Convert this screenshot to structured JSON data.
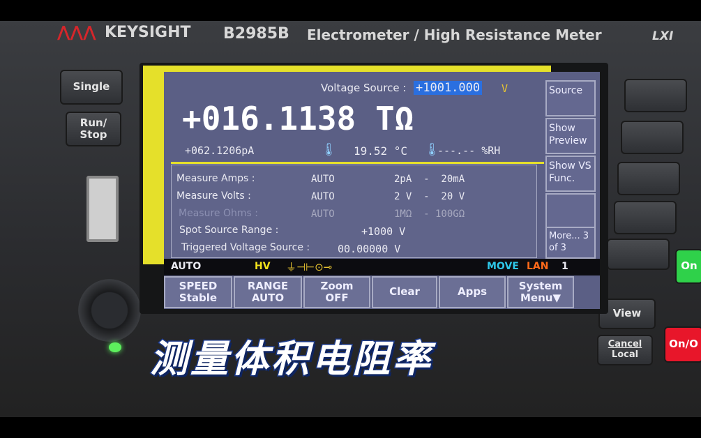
{
  "device": {
    "brand": "KEYSIGHT",
    "model": "B2985B",
    "description": "Electrometer / High Resistance Meter",
    "lxi": "LXI"
  },
  "left_keys": {
    "single": "Single",
    "run_stop": "Run/ Stop"
  },
  "right_keys": {
    "view": "View",
    "cancel": "Cancel",
    "local": "Local",
    "on": "On",
    "on_off": "On/O"
  },
  "screen": {
    "voltage_source_label": "Voltage Source :",
    "voltage_source_value": "+1001.000",
    "voltage_source_unit": "V",
    "main_reading": "+016.1138 TΩ",
    "current_reading": "+062.1206pA",
    "temperature": "19.52 °C",
    "humidity": "---.-- %RH",
    "rows": [
      {
        "label": "Measure Amps :",
        "mode": "AUTO",
        "range": "2pA  -  20mA",
        "dim": false
      },
      {
        "label": "Measure Volts :",
        "mode": "AUTO",
        "range": "2 V  -  20 V",
        "dim": false
      },
      {
        "label": "Measure Ohms :",
        "mode": "AUTO",
        "range": "1MΩ  - 100GΩ",
        "dim": true
      },
      {
        "label": "Spot Source Range :",
        "mode": "",
        "range": "+1000 V",
        "dim": false
      },
      {
        "label": "Triggered Voltage Source :",
        "mode": "",
        "range": "00.00000 V",
        "dim": false
      }
    ],
    "softkeys": [
      "Source",
      "Show Preview",
      "Show VS Func.",
      "",
      "More... 3 of 3"
    ],
    "status": {
      "mode": "AUTO",
      "hv": "HV",
      "move": "MOVE",
      "lan": "LAN",
      "num": "1"
    },
    "function_keys": [
      {
        "top": "SPEED",
        "bottom": "Stable"
      },
      {
        "top": "RANGE",
        "bottom": "AUTO"
      },
      {
        "top": "Zoom",
        "bottom": "OFF"
      },
      {
        "top": "Clear",
        "bottom": ""
      },
      {
        "top": "Apps",
        "bottom": ""
      },
      {
        "top": "System",
        "bottom": "Menu▼"
      }
    ]
  },
  "caption": "测量体积电阻率",
  "colors": {
    "screen_bg": "#5b5f85",
    "highlight": "#2a6fe0",
    "warn_yellow": "#e5e02a",
    "move": "#2ec7e8",
    "lan": "#ff6a1a"
  }
}
